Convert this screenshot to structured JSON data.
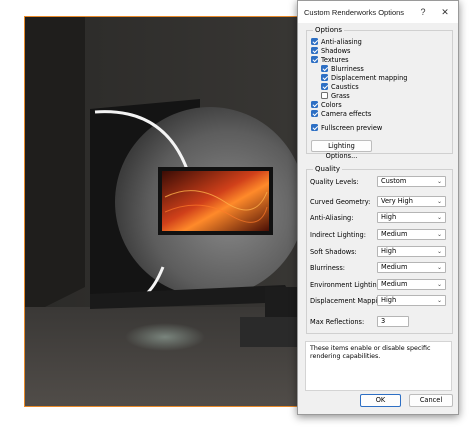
{
  "dialog": {
    "title": "Custom Renderworks Options",
    "help_glyph": "?",
    "close_glyph": "✕",
    "options": {
      "legend": "Options",
      "items": [
        {
          "label": "Anti-aliasing",
          "checked": true
        },
        {
          "label": "Shadows",
          "checked": true
        },
        {
          "label": "Textures",
          "checked": true
        },
        {
          "label": "Blurriness",
          "checked": true
        },
        {
          "label": "Displacement mapping",
          "checked": true
        },
        {
          "label": "Caustics",
          "checked": true
        },
        {
          "label": "Grass",
          "checked": false
        },
        {
          "label": "Colors",
          "checked": true
        },
        {
          "label": "Camera effects",
          "checked": true
        },
        {
          "label": "Fullscreen preview",
          "checked": true
        }
      ],
      "lighting_button": "Lighting Options..."
    },
    "quality": {
      "legend": "Quality",
      "rows": [
        {
          "label": "Quality Levels:",
          "value": "Custom"
        },
        {
          "label": "Curved Geometry:",
          "value": "Very High"
        },
        {
          "label": "Anti-Aliasing:",
          "value": "High"
        },
        {
          "label": "Indirect Lighting:",
          "value": "Medium"
        },
        {
          "label": "Soft Shadows:",
          "value": "High"
        },
        {
          "label": "Blurriness:",
          "value": "Medium"
        },
        {
          "label": "Environment Lighting:",
          "value": "Medium"
        },
        {
          "label": "Displacement Mapping:",
          "value": "High"
        }
      ],
      "max_reflections_label": "Max Reflections:",
      "max_reflections_value": "3"
    },
    "note": "These items enable or disable specific rendering capabilities.",
    "ok_label": "OK",
    "cancel_label": "Cancel"
  },
  "colors": {
    "accent": "#2d6fc4",
    "viewport_border": "#e88a2a"
  }
}
